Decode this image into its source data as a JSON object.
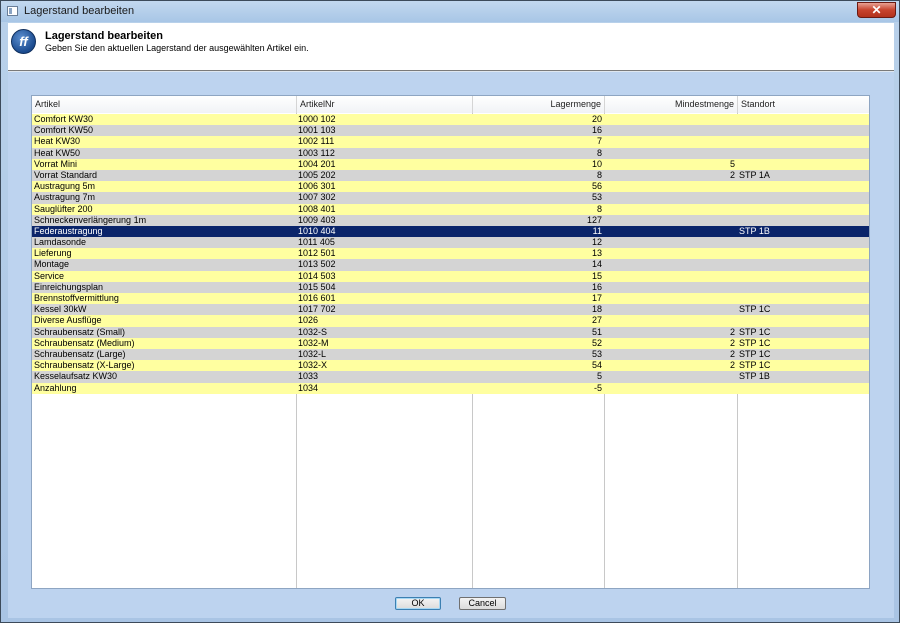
{
  "window": {
    "title": "Lagerstand bearbeiten",
    "close_label": "✕"
  },
  "header": {
    "logo_text": "ff",
    "title": "Lagerstand bearbeiten",
    "subtitle": "Geben Sie den aktuellen Lagerstand der ausgewählten Artikel ein."
  },
  "table": {
    "columns": [
      "Artikel",
      "ArtikelNr",
      "Lagermenge",
      "Mindestmenge",
      "Standort"
    ],
    "selected_index": 10,
    "rows": [
      [
        "Comfort KW30",
        "1000 102",
        "20",
        "",
        ""
      ],
      [
        "Comfort KW50",
        "1001 103",
        "16",
        "",
        ""
      ],
      [
        "Heat KW30",
        "1002 111",
        "7",
        "",
        ""
      ],
      [
        "Heat KW50",
        "1003 112",
        "8",
        "",
        ""
      ],
      [
        "Vorrat Mini",
        "1004 201",
        "10",
        "5",
        ""
      ],
      [
        "Vorrat Standard",
        "1005 202",
        "8",
        "2",
        "STP 1A"
      ],
      [
        "Austragung 5m",
        "1006 301",
        "56",
        "",
        ""
      ],
      [
        "Austragung 7m",
        "1007 302",
        "53",
        "",
        ""
      ],
      [
        "Sauglüfter 200",
        "1008 401",
        "8",
        "",
        ""
      ],
      [
        "Schneckenverlängerung 1m",
        "1009 403",
        "127",
        "",
        ""
      ],
      [
        "Federaustragung",
        "1010 404",
        "11",
        "",
        "STP 1B"
      ],
      [
        "Lamdasonde",
        "1011 405",
        "12",
        "",
        ""
      ],
      [
        "Lieferung",
        "1012 501",
        "13",
        "",
        ""
      ],
      [
        "Montage",
        "1013 502",
        "14",
        "",
        ""
      ],
      [
        "Service",
        "1014 503",
        "15",
        "",
        ""
      ],
      [
        "Einreichungsplan",
        "1015 504",
        "16",
        "",
        ""
      ],
      [
        "Brennstoffvermittlung",
        "1016 601",
        "17",
        "",
        ""
      ],
      [
        "Kessel 30kW",
        "1017 702",
        "18",
        "",
        "STP 1C"
      ],
      [
        "Diverse Ausflüge",
        "1026",
        "27",
        "",
        ""
      ],
      [
        "Schraubensatz (Small)",
        "1032-S",
        "51",
        "2",
        "STP 1C"
      ],
      [
        "Schraubensatz (Medium)",
        "1032-M",
        "52",
        "2",
        "STP 1C"
      ],
      [
        "Schraubensatz (Large)",
        "1032-L",
        "53",
        "2",
        "STP 1C"
      ],
      [
        "Schraubensatz (X-Large)",
        "1032-X",
        "54",
        "2",
        "STP 1C"
      ],
      [
        "Kesselaufsatz KW30",
        "1033",
        "5",
        "",
        "STP 1B"
      ],
      [
        "Anzahlung",
        "1034",
        "-5",
        "",
        ""
      ]
    ]
  },
  "buttons": {
    "ok_label": "OK",
    "cancel_label": "Cancel"
  },
  "colors": {
    "row_odd": "#ffffa0",
    "row_even": "#d4d4d4",
    "row_selected": "#0a246a"
  }
}
